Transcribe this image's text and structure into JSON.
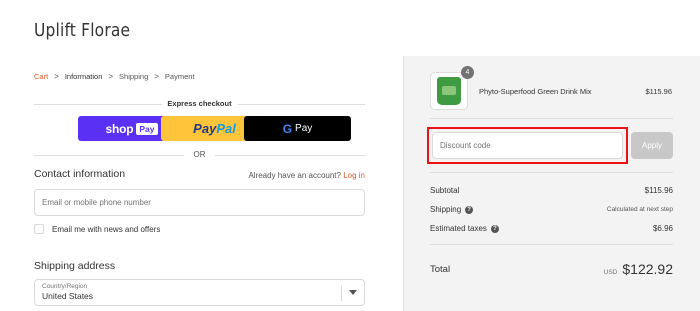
{
  "store": {
    "title": "Uplift Florae"
  },
  "breadcrumb": {
    "items": [
      {
        "label": "Cart"
      },
      {
        "label": "Information"
      },
      {
        "label": "Shipping"
      },
      {
        "label": "Payment"
      }
    ],
    "separator": ">"
  },
  "express_checkout": {
    "label": "Express checkout",
    "shop_pay": {
      "text": "shop",
      "box": "Pay"
    },
    "paypal": {
      "pay": "Pay",
      "pal": "Pal"
    },
    "gpay": {
      "g": "G",
      "text": "Pay"
    },
    "or_label": "OR"
  },
  "contact": {
    "heading": "Contact information",
    "account_prompt": "Already have an account?",
    "login_label": "Log in",
    "input_placeholder": "Email or mobile phone number",
    "newsletter_label": "Email me with news and offers"
  },
  "shipping": {
    "heading": "Shipping address",
    "country_label": "Country/Region",
    "country_value": "United States"
  },
  "summary": {
    "product": {
      "name": "Phyto-Superfood Green Drink Mix",
      "price": "$115.96",
      "quantity": "4"
    },
    "discount": {
      "placeholder": "Discount code",
      "apply_label": "Apply"
    },
    "subtotal": {
      "label": "Subtotal",
      "value": "$115.96"
    },
    "shipping": {
      "label": "Shipping",
      "value": "Calculated at next step"
    },
    "taxes": {
      "label": "Estimated taxes",
      "value": "$6.96"
    },
    "total": {
      "label": "Total",
      "currency": "USD",
      "value": "$122.92"
    }
  },
  "colors": {
    "accent": "#e0572c",
    "panel_bg": "#f3f3f3",
    "highlight": "#ee1111",
    "shop_pay": "#5a31f4",
    "paypal": "#ffc439"
  }
}
